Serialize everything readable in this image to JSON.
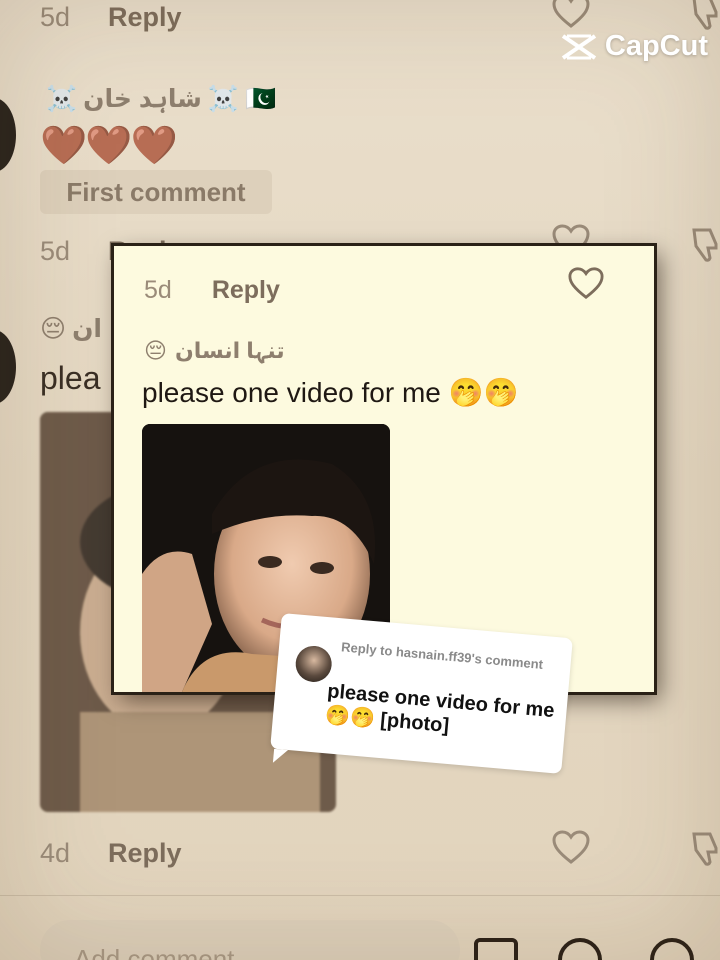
{
  "watermark": {
    "brand": "CapCut"
  },
  "background_comments": [
    {
      "date": "5d",
      "reply_label": "Reply"
    },
    {
      "date": "5d",
      "reply_label": "Reply"
    },
    {
      "date": "4d",
      "reply_label": "Reply"
    }
  ],
  "comment_1": {
    "username": "شاہد خان",
    "skull_left": "☠️",
    "skull_right": "☠️",
    "flag": "🇵🇰",
    "text": "🤎🤎🤎",
    "tag": "First comment"
  },
  "comment_2_partial": {
    "username_emoji": "😔",
    "username_fragment": "ان",
    "text_fragment": "plea"
  },
  "bottom_bar": {
    "placeholder": "Add comment..."
  },
  "card": {
    "date": "5d",
    "reply_label": "Reply",
    "username": "تنہا انسان",
    "username_emoji": "😔",
    "text": "please one video for me 🤭🤭"
  },
  "reply_sticker": {
    "header": "Reply to hasnain.ff39's comment",
    "text": "please one video for me 🤭🤭 [photo]"
  },
  "colors": {
    "card_bg": "#fdfadf",
    "page_bg": "#e8dcc8",
    "accent_text": "#7d6d5c"
  }
}
